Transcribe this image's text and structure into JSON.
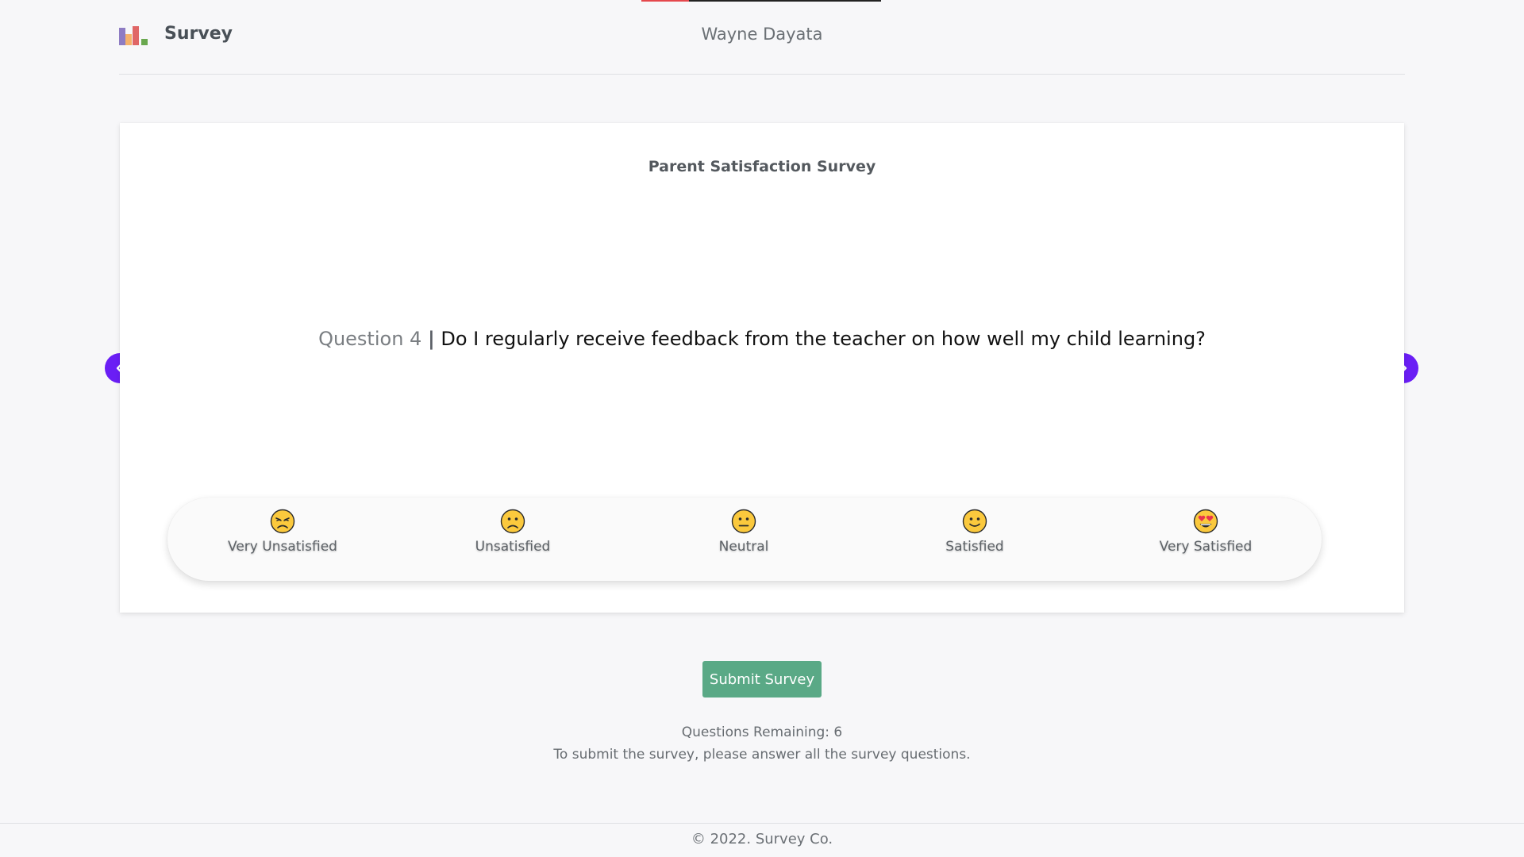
{
  "progress": {
    "fraction": 0.2
  },
  "header": {
    "brand": "Survey",
    "user_name": "Wayne Dayata",
    "logo_colors": [
      "#8e7cc3",
      "#f6b26b",
      "#e06666",
      "#6aa84f"
    ]
  },
  "survey": {
    "title": "Parent Satisfaction Survey",
    "question_number": "Question 4",
    "separator": "|",
    "question_text": "Do I regularly receive feedback from the teacher on how well my child learning?"
  },
  "nav": {
    "prev_icon": "chevron-left-icon",
    "next_icon": "chevron-right-icon",
    "accent": "#6a1ef5"
  },
  "options": [
    {
      "label": "Very Unsatisfied",
      "icon": "unamused-face-icon"
    },
    {
      "label": "Unsatisfied",
      "icon": "frowning-face-icon"
    },
    {
      "label": "Neutral",
      "icon": "neutral-face-icon"
    },
    {
      "label": "Satisfied",
      "icon": "smiling-face-icon"
    },
    {
      "label": "Very Satisfied",
      "icon": "heart-eyes-face-icon"
    }
  ],
  "submit": {
    "label": "Submit Survey",
    "color": "#5aa986"
  },
  "status": {
    "remaining": "Questions Remaining: 6",
    "hint": "To submit the survey, please answer all the survey questions."
  },
  "footer": {
    "copyright": "© 2022. Survey Co."
  }
}
